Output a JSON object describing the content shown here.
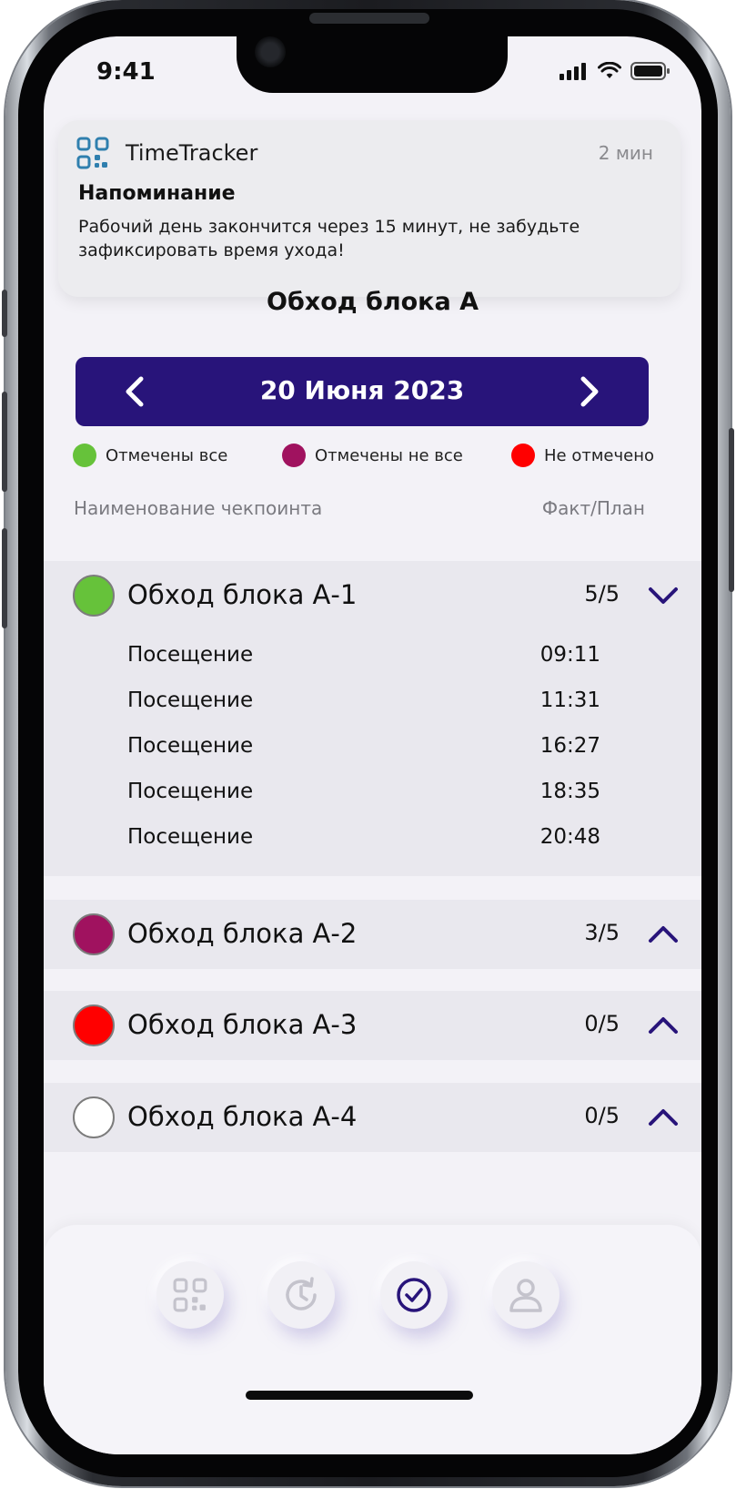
{
  "status_bar": {
    "time": "9:41"
  },
  "notification": {
    "app_name": "TimeTracker",
    "time_ago": "2 мин",
    "title": "Напоминание",
    "body": "Рабочий день закончится через 15 минут, не забудьте зафиксировать время ухода!"
  },
  "page": {
    "title": "Обход блока А"
  },
  "date_nav": {
    "date_label": "20 Июня 2023"
  },
  "legend": [
    {
      "label": "Отмечены все",
      "color": "#66c23a"
    },
    {
      "label": "Отмечены не все",
      "color": "#a0125f"
    },
    {
      "label": "Не отмечено",
      "color": "#ff0000"
    }
  ],
  "table_header": {
    "name": "Наименование чекпоинта",
    "ratio": "Факт/План"
  },
  "checkpoints": [
    {
      "name": "Обход блока А-1",
      "count": "5/5",
      "color": "#66c23a",
      "expanded": true,
      "visits": [
        {
          "label": "Посещение",
          "time": "09:11"
        },
        {
          "label": "Посещение",
          "time": "11:31"
        },
        {
          "label": "Посещение",
          "time": "16:27"
        },
        {
          "label": "Посещение",
          "time": "18:35"
        },
        {
          "label": "Посещение",
          "time": "20:48"
        }
      ]
    },
    {
      "name": "Обход блока А-2",
      "count": "3/5",
      "color": "#a0125f",
      "expanded": false
    },
    {
      "name": "Обход блока А-3",
      "count": "0/5",
      "color": "#ff0000",
      "expanded": false
    },
    {
      "name": "Обход блока А-4",
      "count": "0/5",
      "color": "#ffffff",
      "expanded": false
    }
  ],
  "tabbar": {
    "items": [
      "qr-code-icon",
      "history-icon",
      "checkpoints-icon",
      "profile-icon"
    ],
    "active": "checkpoints-icon"
  },
  "colors": {
    "accent": "#28147a",
    "background": "#f3f2f7",
    "row_background": "#e9e8ee"
  }
}
